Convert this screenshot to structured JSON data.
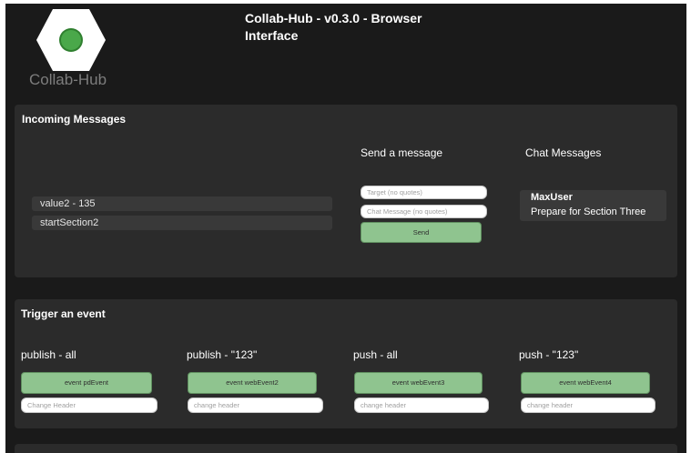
{
  "header": {
    "logo_text": "Collab-Hub",
    "title": "Collab-Hub - v0.3.0 - Browser Interface"
  },
  "incoming": {
    "title": "Incoming Messages",
    "messages": [
      "value2 - 135",
      "startSection2"
    ]
  },
  "send": {
    "title": "Send a message",
    "target_placeholder": "Target (no quotes)",
    "message_placeholder": "Chat Message (no quotes)",
    "send_label": "Send"
  },
  "chat": {
    "title": "Chat Messages",
    "user": "MaxUser",
    "text": "Prepare for Section Three"
  },
  "events": {
    "title": "Trigger an event",
    "columns": [
      {
        "label": "publish - all",
        "button": "event pdEvent",
        "placeholder": "Change Header"
      },
      {
        "label": "publish - \"123\"",
        "button": "event webEvent2",
        "placeholder": "change header"
      },
      {
        "label": "push - all",
        "button": "event webEvent3",
        "placeholder": "change header"
      },
      {
        "label": "push - \"123\"",
        "button": "event webEvent4",
        "placeholder": "change header"
      }
    ]
  },
  "colors": {
    "background": "#1a1a1a",
    "panel": "#2b2b2b",
    "button_green": "#8fc48f",
    "logo_green": "#3f9a3f"
  }
}
